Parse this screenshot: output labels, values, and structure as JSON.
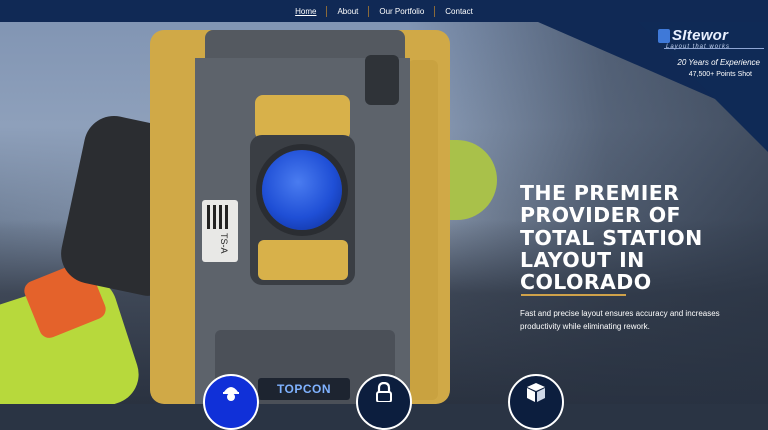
{
  "nav": {
    "items": [
      {
        "label": "Home",
        "active": true
      },
      {
        "label": "About",
        "active": false
      },
      {
        "label": "Our Portfolio",
        "active": false
      },
      {
        "label": "Contact",
        "active": false
      }
    ]
  },
  "logo": {
    "name": "SItewor",
    "tagline": "Layout that works"
  },
  "badge": {
    "years": "20 Years of Experience",
    "points": "47,500+ Points Shot"
  },
  "hero": {
    "headline": "The Premier Provider of Total Station Layout in Colorado",
    "subtext": "Fast and precise layout ensures accuracy and increases productivity while eliminating rework.",
    "instrument_brand": "TOPCON",
    "instrument_label": "TS-A"
  },
  "services": [
    {
      "icon": "worker-icon"
    },
    {
      "icon": "lock-icon"
    },
    {
      "icon": "box-icon"
    }
  ],
  "colors": {
    "nav_bg": "#102955",
    "accent_gold": "#cfa24a",
    "instrument_yellow": "#d0a947",
    "lens_blue": "#1f4fd6"
  }
}
